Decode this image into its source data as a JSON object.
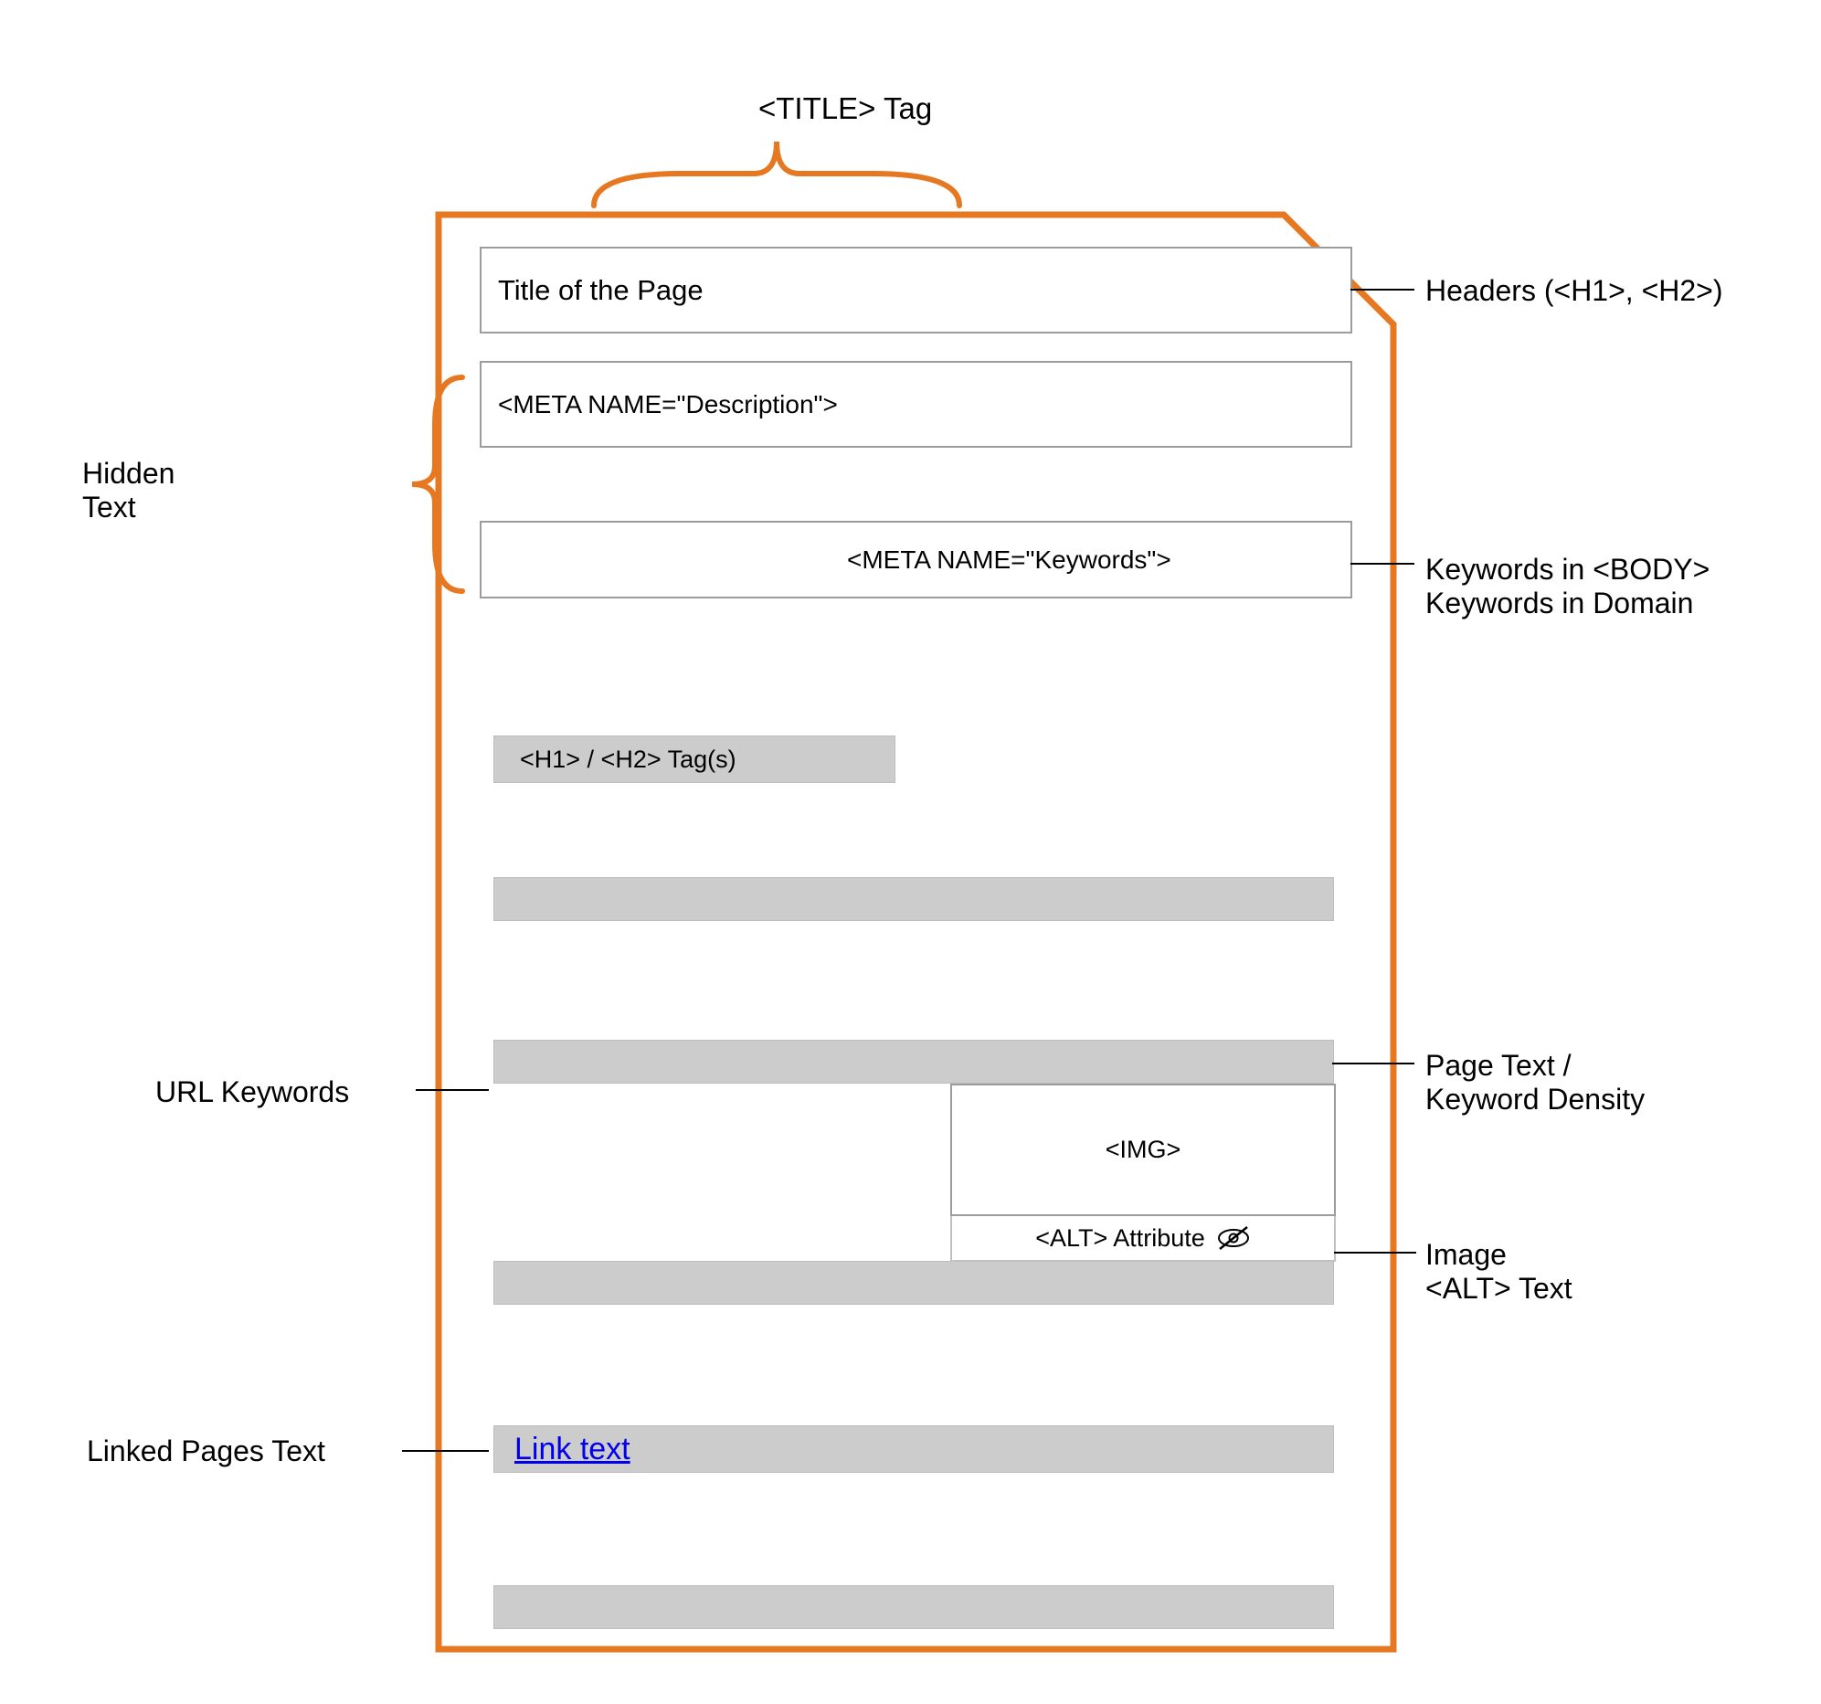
{
  "labels": {
    "title_tag": "﻿<TITLE> Tag",
    "hidden_text": "Hidden\nText",
    "url_keywords": "URL Keywords",
    "linked_pages": "Linked Pages Text",
    "headers": "Headers (<H1>, <H2>)",
    "keywords_domain": "Keywords in <BODY>\nKeywords in Domain",
    "page_text": "Page Text /\nKeyword Density",
    "image_alt_text": "Image\n<ALT> Text"
  },
  "boxes": {
    "title": "Title of the Page",
    "meta_description": "<META NAME=\"Description\">",
    "meta_keywords": "<META NAME=\"Keywords\">",
    "h1h2": "<H1> / <H2> Tag(s)",
    "img": "<IMG>",
    "alt_attr": "<ALT> Attribute",
    "link_text": "Link text"
  }
}
